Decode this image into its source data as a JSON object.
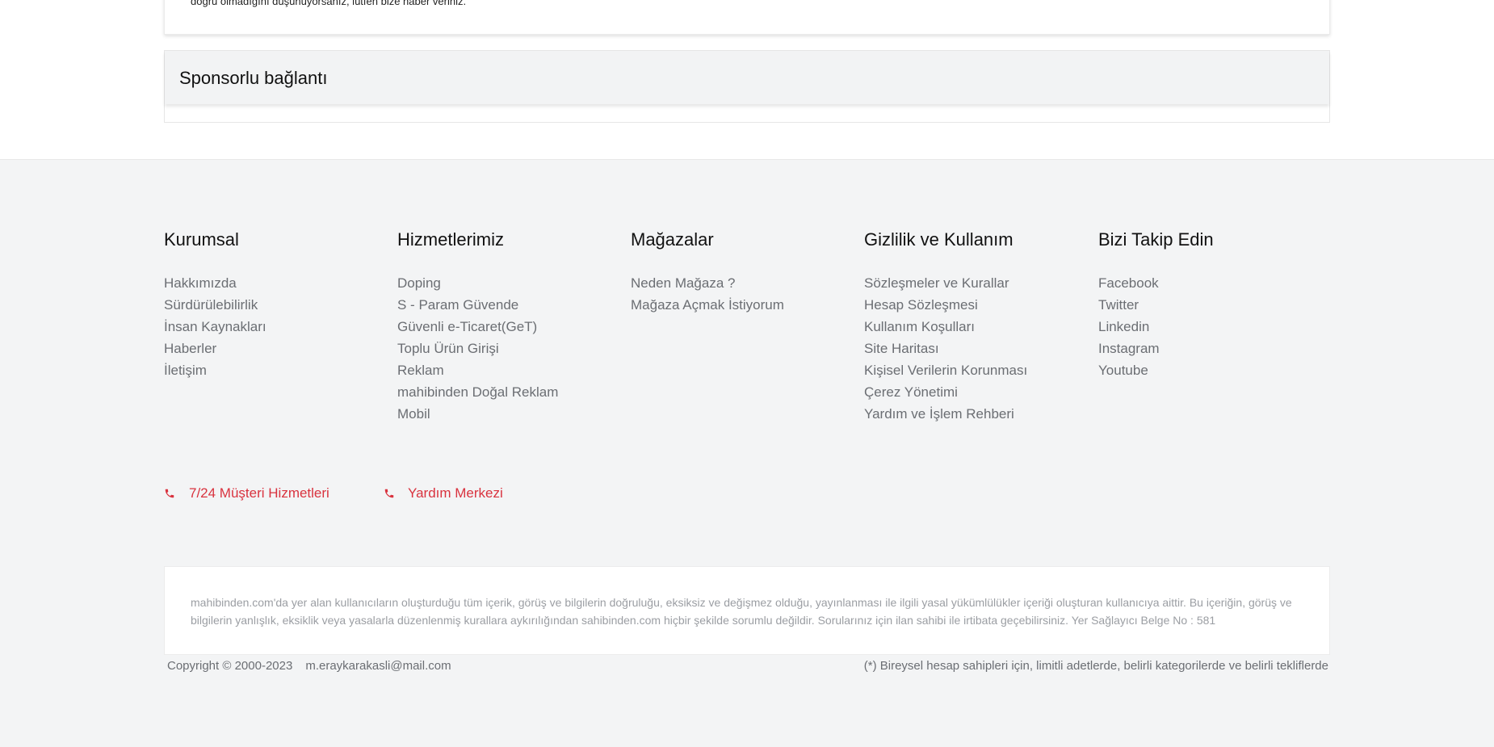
{
  "notice": {
    "text": "doğru olmadığını düşünüyorsanız, lütfen bize haber veriniz."
  },
  "sponsor": {
    "title": "Sponsorlu bağlantı"
  },
  "footer": {
    "columns": [
      {
        "title": "Kurumsal",
        "links": [
          "Hakkımızda",
          "Sürdürülebilirlik",
          "İnsan Kaynakları",
          "Haberler",
          "İletişim"
        ]
      },
      {
        "title": "Hizmetlerimiz",
        "links": [
          "Doping",
          "S - Param Güvende",
          "Güvenli e-Ticaret(GeT)",
          "Toplu Ürün Girişi",
          "Reklam",
          "mahibinden Doğal Reklam",
          "Mobil"
        ]
      },
      {
        "title": "Mağazalar",
        "links": [
          "Neden Mağaza ?",
          "Mağaza Açmak İstiyorum"
        ]
      },
      {
        "title": "Gizlilik ve Kullanım",
        "links": [
          "Sözleşmeler ve Kurallar",
          "Hesap Sözleşmesi",
          "Kullanım Koşulları",
          "Site Haritası",
          "Kişisel Verilerin Korunması",
          "Çerez Yönetimi",
          "Yardım ve İşlem Rehberi"
        ]
      },
      {
        "title": "Bizi Takip Edin",
        "links": [
          "Facebook",
          "Twitter",
          "Linkedin",
          "Instagram",
          "Youtube"
        ]
      }
    ],
    "support": {
      "customer_service": "7/24 Müşteri Hizmetleri",
      "help_center": "Yardım Merkezi",
      "accent_color": "#d9333f",
      "icon": "phone-icon"
    },
    "disclaimer": "mahibinden.com'da yer alan kullanıcıların oluşturduğu tüm içerik, görüş ve bilgilerin doğruluğu, eksiksiz ve değişmez olduğu, yayınlanması ile ilgili yasal yükümlülükler içeriği oluşturan kullanıcıya aittir. Bu içeriğin, görüş ve bilgilerin yanlışlık, eksiklik veya yasalarla düzenlenmiş kurallara aykırılığından sahibinden.com hiçbir şekilde sorumlu değildir. Sorularınız için ilan sahibi ile irtibata geçebilirsiniz. Yer Sağlayıcı Belge No : 581",
    "copyright": "Copyright © 2000-2023",
    "email": "m.eraykarakasli@mail.com",
    "note": "(*) Bireysel hesap sahipleri için, limitli adetlerde, belirli kategorilerde ve belirli tekliflerde"
  }
}
